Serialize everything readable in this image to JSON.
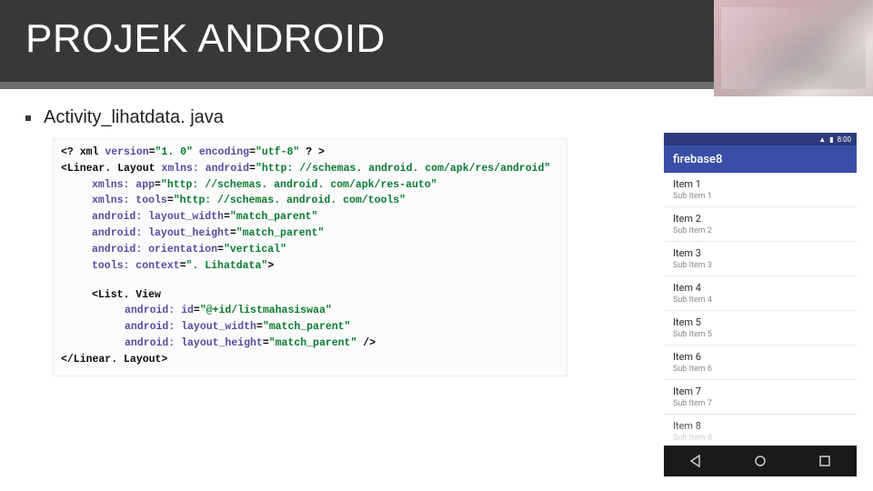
{
  "slide": {
    "title": "PROJEK ANDROID",
    "bullet_filename": "Activity_lihatdata. java"
  },
  "code": {
    "l1_a": "<? xml ",
    "l1_b": "version",
    "l1_c": "=",
    "l1_d": "\"1. 0\" ",
    "l1_e": "encoding",
    "l1_f": "=",
    "l1_g": "\"utf-8\" ",
    "l1_h": "? >",
    "l2_a": "<Linear. Layout ",
    "l2_b": "xmlns: android",
    "l2_c": "=",
    "l2_d": "\"http: //schemas. android. com/apk/res/android\"",
    "l3_a": "xmlns: app",
    "l3_b": "=",
    "l3_c": "\"http: //schemas. android. com/apk/res-auto\"",
    "l4_a": "xmlns: tools",
    "l4_b": "=",
    "l4_c": "\"http: //schemas. android. com/tools\"",
    "l5_a": "android: layout_width",
    "l5_b": "=",
    "l5_c": "\"match_parent\"",
    "l6_a": "android: layout_height",
    "l6_b": "=",
    "l6_c": "\"match_parent\"",
    "l7_a": "android: orientation",
    "l7_b": "=",
    "l7_c": "\"vertical\"",
    "l8_a": "tools: context",
    "l8_b": "=",
    "l8_c": "\". Lihatdata\"",
    "l8_d": ">",
    "l9_a": "<List. View",
    "l10_a": "android: id",
    "l10_b": "=",
    "l10_c": "\"@+id/listmahasiswaa\"",
    "l11_a": "android: layout_width",
    "l11_b": "=",
    "l11_c": "\"match_parent\"",
    "l12_a": "android: layout_height",
    "l12_b": "=",
    "l12_c": "\"match_parent\" ",
    "l12_d": "/>",
    "l13": "</Linear. Layout>"
  },
  "phone": {
    "appbar_title": "firebase8",
    "status": {
      "time": "8:00",
      "battery": "▮",
      "signal": "▲"
    },
    "items": [
      {
        "t": "Item 1",
        "s": "Sub Item 1"
      },
      {
        "t": "Item 2",
        "s": "Sub Item 2"
      },
      {
        "t": "Item 3",
        "s": "Sub Item 3"
      },
      {
        "t": "Item 4",
        "s": "Sub Item 4"
      },
      {
        "t": "Item 5",
        "s": "Sub Item 5"
      },
      {
        "t": "Item 6",
        "s": "Sub Item 6"
      },
      {
        "t": "Item 7",
        "s": "Sub Item 7"
      },
      {
        "t": "Item 8",
        "s": "Sub Item 8"
      }
    ]
  }
}
